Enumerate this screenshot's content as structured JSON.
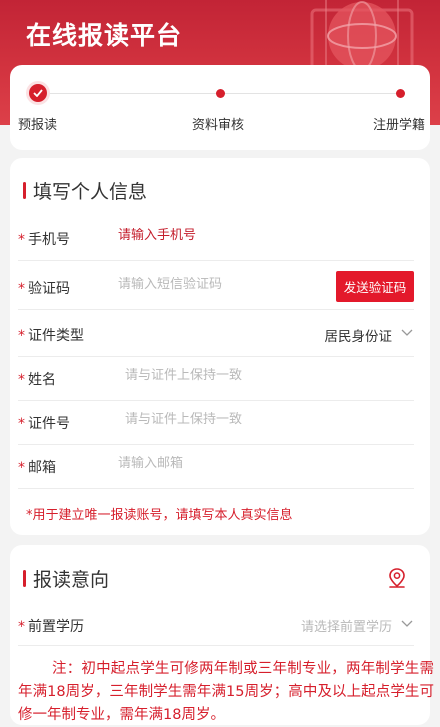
{
  "header": {
    "title": "在线报读平台"
  },
  "stepper": {
    "steps": [
      {
        "label": "预报读",
        "state": "done"
      },
      {
        "label": "资料审核",
        "state": "pending"
      },
      {
        "label": "注册学籍",
        "state": "pending"
      }
    ],
    "accent": "#d61f2c"
  },
  "personal": {
    "title": "填写个人信息",
    "fields": {
      "phone": {
        "label": "手机号",
        "placeholder": "请输入手机号"
      },
      "code": {
        "label": "验证码",
        "placeholder": "请输入短信验证码",
        "button": "发送验证码"
      },
      "id_type": {
        "label": "证件类型",
        "value": "居民身份证"
      },
      "name": {
        "label": "姓名",
        "placeholder": "请与证件上保持一致"
      },
      "id_no": {
        "label": "证件号",
        "placeholder": "请与证件上保持一致"
      },
      "email": {
        "label": "邮箱",
        "placeholder": "请输入邮箱"
      }
    },
    "required_mark": "*",
    "note": "*用于建立唯一报读账号，请填写本人真实信息"
  },
  "intent": {
    "title": "报读意向",
    "fields": {
      "prior_edu": {
        "label": "前置学历",
        "placeholder": "请选择前置学历"
      }
    },
    "notice": "注：初中起点学生可修两年制或三年制专业，两年制学生需年满18周岁，三年制学生需年满15周岁；高中及以上起点学生可修一年制专业，需年满18周岁。"
  },
  "colors": {
    "header": "#c22436",
    "button": "#e3192b",
    "background": "#f3f3f3"
  }
}
